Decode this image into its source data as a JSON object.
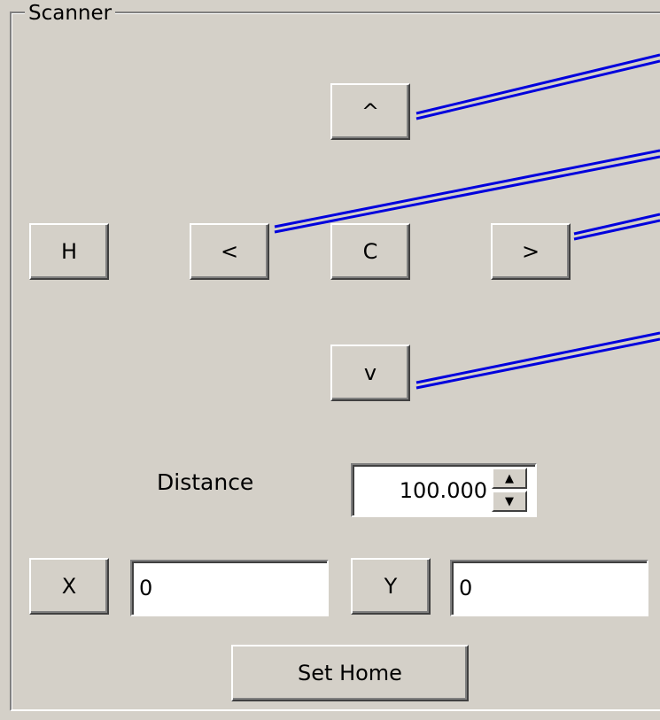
{
  "scanner": {
    "group_label": "Scanner",
    "buttons": {
      "up": "^",
      "left": "<",
      "center": "C",
      "right": ">",
      "down": "v",
      "home": "H",
      "x": "X",
      "y": "Y",
      "set_home": "Set Home"
    },
    "distance": {
      "label": "Distance",
      "value": "100.000"
    },
    "x_value": "0",
    "y_value": "0"
  },
  "colors": {
    "background": "#d4d0c8",
    "annotation_line": "#0000dd"
  },
  "icons": {
    "spin_up": "up-arrow-icon",
    "spin_down": "down-arrow-icon"
  }
}
